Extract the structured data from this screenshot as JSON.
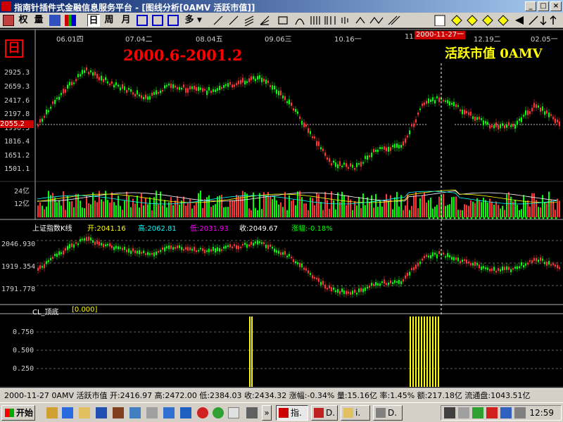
{
  "window": {
    "title": "指南针插件式金融信息服务平台 - [图线分析[0AMV 活跃市值]]"
  },
  "toolbar": {
    "btn_rights": "权",
    "btn_volume": "量",
    "btn_day": "日",
    "btn_week": "周",
    "btn_month": "月",
    "btn_more": "多"
  },
  "chart": {
    "day_badge": "日",
    "range_label": "2000.6-2001.2",
    "name_label": "活跃市值 0AMV",
    "current_date": "2000-11-27一",
    "x_labels": [
      "06.01四",
      "07.04二",
      "08.04五",
      "09.06三",
      "10.16一",
      "11.",
      "12.19二",
      "02.05一"
    ],
    "price_labels": [
      "2925.3",
      "2659.3",
      "2417.6",
      "2197.8",
      "1990.5",
      "1816.4",
      "1651.2",
      "1501.1"
    ],
    "price_badge": "2055.2",
    "vol_labels": [
      "24亿",
      "12亿"
    ],
    "idx": {
      "name": "上证指数K线",
      "open_label": "开:",
      "open": "2041.16",
      "high_label": "高:",
      "high": "2062.81",
      "low_label": "低:",
      "low": "2031.93",
      "close_label": "收:",
      "close": "2049.67",
      "chg_label": "涨幅:",
      "chg": "-0.18%"
    },
    "idx_labels": [
      "2046.930",
      "1919.354",
      "1791.778"
    ],
    "cl": {
      "name": "CL_顶底",
      "value": "[0.000]"
    },
    "cl_labels": [
      "0.750",
      "0.500",
      "0.250"
    ]
  },
  "status_bar": {
    "text": "2000-11-27 0AMV 活跃市值 开:2416.97 高:2472.00 低:2384.03 收:2434.32 涨幅:-0.34% 量:15.16亿 率:1.45% 额:217.18亿 流通盘:1043.51亿"
  },
  "taskbar": {
    "start": "开始",
    "task1": "指.",
    "task2": "D.",
    "task3": "i.",
    "task4": "D.",
    "clock": "12:59"
  },
  "colors": {
    "up": "#ff3333",
    "down": "#00ff00",
    "accent": "#ffff00"
  }
}
